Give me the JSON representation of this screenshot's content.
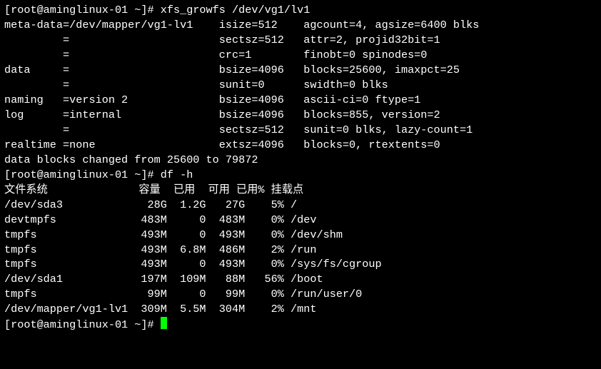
{
  "prompt1": "[root@aminglinux-01 ~]# ",
  "cmd1": "xfs_growfs /dev/vg1/lv1",
  "meta_lines": [
    "meta-data=/dev/mapper/vg1-lv1    isize=512    agcount=4, agsize=6400 blks",
    "         =                       sectsz=512   attr=2, projid32bit=1",
    "         =                       crc=1        finobt=0 spinodes=0",
    "data     =                       bsize=4096   blocks=25600, imaxpct=25",
    "         =                       sunit=0      swidth=0 blks",
    "naming   =version 2              bsize=4096   ascii-ci=0 ftype=1",
    "log      =internal               bsize=4096   blocks=855, version=2",
    "         =                       sectsz=512   sunit=0 blks, lazy-count=1",
    "realtime =none                   extsz=4096   blocks=0, rtextents=0"
  ],
  "changed_line": "data blocks changed from 25600 to 79872",
  "prompt2": "[root@aminglinux-01 ~]# ",
  "cmd2": "df -h",
  "df_header": "文件系统              容量  已用  可用 已用% 挂载点",
  "df_rows": [
    "/dev/sda3             28G  1.2G   27G    5% /",
    "devtmpfs             483M     0  483M    0% /dev",
    "tmpfs                493M     0  493M    0% /dev/shm",
    "tmpfs                493M  6.8M  486M    2% /run",
    "tmpfs                493M     0  493M    0% /sys/fs/cgroup",
    "/dev/sda1            197M  109M   88M   56% /boot",
    "tmpfs                 99M     0   99M    0% /run/user/0",
    "/dev/mapper/vg1-lv1  309M  5.5M  304M    2% /mnt"
  ],
  "prompt3": "[root@aminglinux-01 ~]# ",
  "chart_data": {
    "type": "table",
    "title": "df -h output",
    "columns": [
      "文件系统",
      "容量",
      "已用",
      "可用",
      "已用%",
      "挂载点"
    ],
    "rows": [
      {
        "filesystem": "/dev/sda3",
        "size": "28G",
        "used": "1.2G",
        "avail": "27G",
        "use_pct": "5%",
        "mount": "/"
      },
      {
        "filesystem": "devtmpfs",
        "size": "483M",
        "used": "0",
        "avail": "483M",
        "use_pct": "0%",
        "mount": "/dev"
      },
      {
        "filesystem": "tmpfs",
        "size": "493M",
        "used": "0",
        "avail": "493M",
        "use_pct": "0%",
        "mount": "/dev/shm"
      },
      {
        "filesystem": "tmpfs",
        "size": "493M",
        "used": "6.8M",
        "avail": "486M",
        "use_pct": "2%",
        "mount": "/run"
      },
      {
        "filesystem": "tmpfs",
        "size": "493M",
        "used": "0",
        "avail": "493M",
        "use_pct": "0%",
        "mount": "/sys/fs/cgroup"
      },
      {
        "filesystem": "/dev/sda1",
        "size": "197M",
        "used": "109M",
        "avail": "88M",
        "use_pct": "56%",
        "mount": "/boot"
      },
      {
        "filesystem": "tmpfs",
        "size": "99M",
        "used": "0",
        "avail": "99M",
        "use_pct": "0%",
        "mount": "/run/user/0"
      },
      {
        "filesystem": "/dev/mapper/vg1-lv1",
        "size": "309M",
        "used": "5.5M",
        "avail": "304M",
        "use_pct": "2%",
        "mount": "/mnt"
      }
    ]
  },
  "xfs_growfs_info": {
    "device": "/dev/mapper/vg1-lv1",
    "meta_data": {
      "isize": 512,
      "agcount": 4,
      "agsize": 6400,
      "sectsz": 512,
      "attr": 2,
      "projid32bit": 1,
      "crc": 1,
      "finobt": 0,
      "spinodes": 0
    },
    "data": {
      "bsize": 4096,
      "blocks": 25600,
      "imaxpct": 25,
      "sunit": 0,
      "swidth": 0
    },
    "naming": {
      "version": 2,
      "bsize": 4096,
      "ascii_ci": 0,
      "ftype": 1
    },
    "log": {
      "type": "internal",
      "bsize": 4096,
      "blocks": 855,
      "version": 2,
      "sectsz": 512,
      "sunit": 0,
      "lazy_count": 1
    },
    "realtime": {
      "type": "none",
      "extsz": 4096,
      "blocks": 0,
      "rtextents": 0
    },
    "data_blocks_changed": {
      "from": 25600,
      "to": 79872
    }
  }
}
